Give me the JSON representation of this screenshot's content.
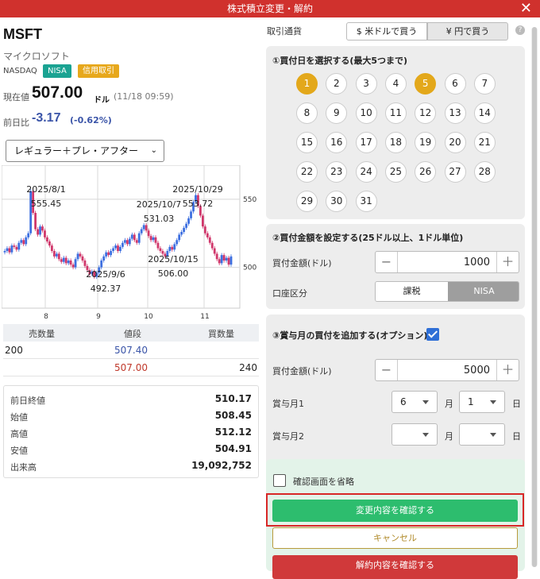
{
  "window": {
    "title": "株式積立変更・解約",
    "close": "✕"
  },
  "stock": {
    "ticker": "MSFT",
    "name": "マイクロソフト",
    "market": "NASDAQ",
    "badges": [
      "NISA",
      "信用取引"
    ],
    "price_label": "現在値",
    "price": "507.00",
    "price_unit": "ドル",
    "price_time": "(11/18 09:59)",
    "change_label": "前日比",
    "change": "-3.17",
    "change_pct": "(-0.62%)"
  },
  "session_select": {
    "value": "レギュラー＋プレ・アフター"
  },
  "chart_data": {
    "type": "candlestick",
    "x_ticks": [
      "8",
      "9",
      "10",
      "11"
    ],
    "y_ticks": [
      "550",
      "500"
    ],
    "ylim": [
      470,
      575
    ],
    "annotations": [
      {
        "date": "2025/8/1",
        "value": "555.45"
      },
      {
        "date": "2025/9/6",
        "value": "492.37"
      },
      {
        "date": "2025/10/7",
        "value": "531.03"
      },
      {
        "date": "2025/10/29",
        "value": "553.72"
      },
      {
        "date": "2025/10/15",
        "value": "506.00"
      }
    ],
    "closes": [
      512,
      514,
      511,
      516,
      515,
      513,
      518,
      520,
      517,
      522,
      525,
      556,
      540,
      528,
      524,
      530,
      527,
      522,
      519,
      516,
      512,
      508,
      510,
      506,
      504,
      507,
      503,
      505,
      502,
      500,
      506,
      510,
      508,
      505,
      501,
      498,
      495,
      497,
      493,
      496,
      500,
      505,
      508,
      511,
      509,
      512,
      514,
      516,
      512,
      515,
      518,
      520,
      517,
      521,
      524,
      520,
      518,
      525,
      528,
      531,
      527,
      523,
      520,
      522,
      518,
      514,
      512,
      510,
      508,
      512,
      515,
      513,
      517,
      520,
      524,
      526,
      529,
      532,
      536,
      541,
      548,
      553,
      545,
      538,
      530,
      525,
      522,
      518,
      514,
      510,
      506,
      503,
      509,
      505,
      507,
      502,
      508
    ]
  },
  "order_book": {
    "headers": [
      "売数量",
      "値段",
      "買数量"
    ],
    "rows": [
      {
        "sell_qty": "200",
        "price": "507.40",
        "buy_qty": ""
      },
      {
        "sell_qty": "",
        "price": "507.00",
        "buy_qty": "240"
      }
    ]
  },
  "stats": [
    {
      "label": "前日終値",
      "value": "510.17"
    },
    {
      "label": "始値",
      "value": "508.45"
    },
    {
      "label": "高値",
      "value": "512.12"
    },
    {
      "label": "安値",
      "value": "504.91"
    },
    {
      "label": "出来高",
      "value": "19,092,752"
    }
  ],
  "currency": {
    "label": "取引通貨",
    "usd": "$ 米ドルで買う",
    "jpy": "¥ 円で買う",
    "help": "?"
  },
  "section1": {
    "title": "①買付日を選択する(最大5つまで)",
    "days": [
      "1",
      "2",
      "3",
      "4",
      "5",
      "6",
      "7",
      "8",
      "9",
      "10",
      "11",
      "12",
      "13",
      "14",
      "15",
      "16",
      "17",
      "18",
      "19",
      "20",
      "21",
      "22",
      "23",
      "24",
      "25",
      "26",
      "27",
      "28",
      "29",
      "30",
      "31"
    ],
    "selected": [
      "1",
      "5"
    ]
  },
  "section2": {
    "title": "②買付金額を設定する(25ドル以上、1ドル単位)",
    "amount_label": "買付金額(ドル)",
    "amount": "1000",
    "minus": "−",
    "plus": "＋",
    "account_label": "口座区分",
    "account_options": [
      "課税",
      "NISA"
    ]
  },
  "section3": {
    "title": "③賞与月の買付を追加する(オプション)",
    "amount_label": "買付金額(ドル)",
    "amount": "5000",
    "bonus1_label": "賞与月1",
    "bonus1_month": "6",
    "bonus1_day": "1",
    "bonus2_label": "賞与月2",
    "bonus2_month": "",
    "bonus2_day": "",
    "month_unit": "月",
    "day_unit": "日"
  },
  "footer": {
    "skip_label": "確認画面を省略",
    "confirm_button": "変更内容を確認する",
    "cancel_button": "キャンセル",
    "cancel_confirm_button": "解約内容を確認する"
  }
}
